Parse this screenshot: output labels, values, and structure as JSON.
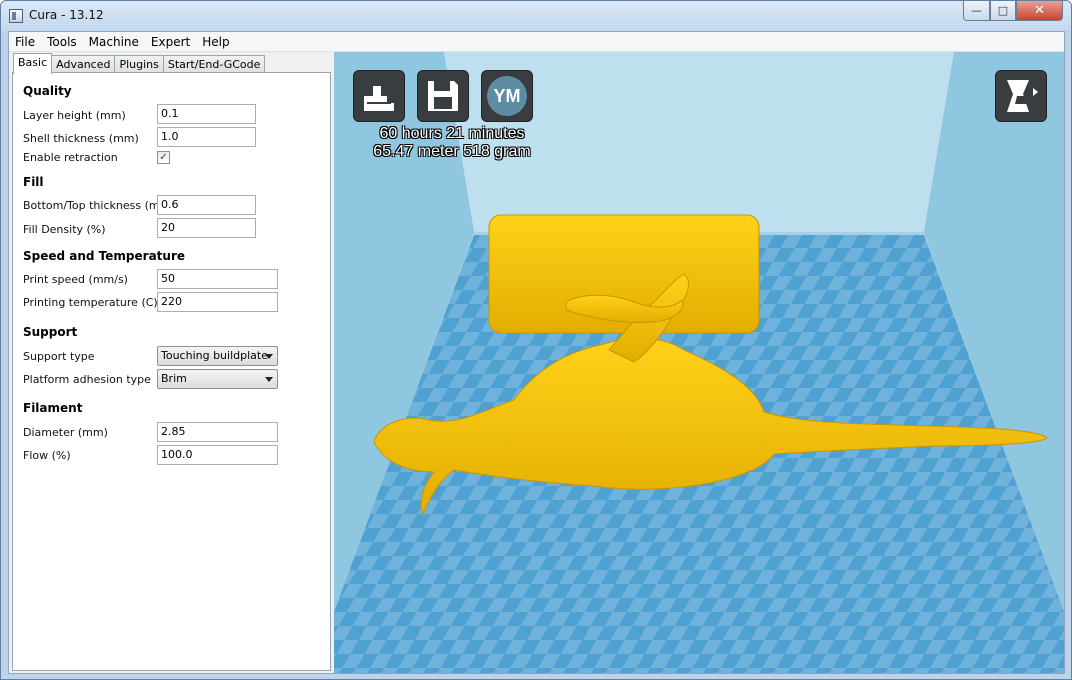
{
  "window": {
    "title": "Cura - 13.12",
    "minimize": "0",
    "maximize": "□",
    "close": "x"
  },
  "menu": [
    "File",
    "Tools",
    "Machine",
    "Expert",
    "Help"
  ],
  "tabs": [
    "Basic",
    "Advanced",
    "Plugins",
    "Start/End-GCode"
  ],
  "sections": {
    "quality": {
      "title": "Quality",
      "layer_height_label": "Layer height (mm)",
      "layer_height": "0.1",
      "shell_thickness_label": "Shell thickness (mm)",
      "shell_thickness": "1.0",
      "enable_retraction_label": "Enable retraction",
      "enable_retraction": true,
      "check_mark": "✓"
    },
    "fill": {
      "title": "Fill",
      "bottom_top_label": "Bottom/Top thickness (mm)",
      "bottom_top": "0.6",
      "fill_density_label": "Fill Density (%)",
      "fill_density": "20"
    },
    "speed": {
      "title": "Speed and Temperature",
      "print_speed_label": "Print speed (mm/s)",
      "print_speed": "50",
      "temperature_label": "Printing temperature (C)",
      "temperature": "220"
    },
    "support": {
      "title": "Support",
      "support_type_label": "Support type",
      "support_type": "Touching buildplate",
      "adhesion_label": "Platform adhesion type",
      "adhesion": "Brim"
    },
    "filament": {
      "title": "Filament",
      "diameter_label": "Diameter (mm)",
      "diameter": "2.85",
      "flow_label": "Flow (%)",
      "flow": "100.0"
    }
  },
  "viewport": {
    "ym_label": "YM",
    "print_time": "60 hours 21 minutes",
    "print_material": "65.47 meter 518 gram",
    "model_color": "#f2c200",
    "plate_color": "#5aa9d6"
  }
}
